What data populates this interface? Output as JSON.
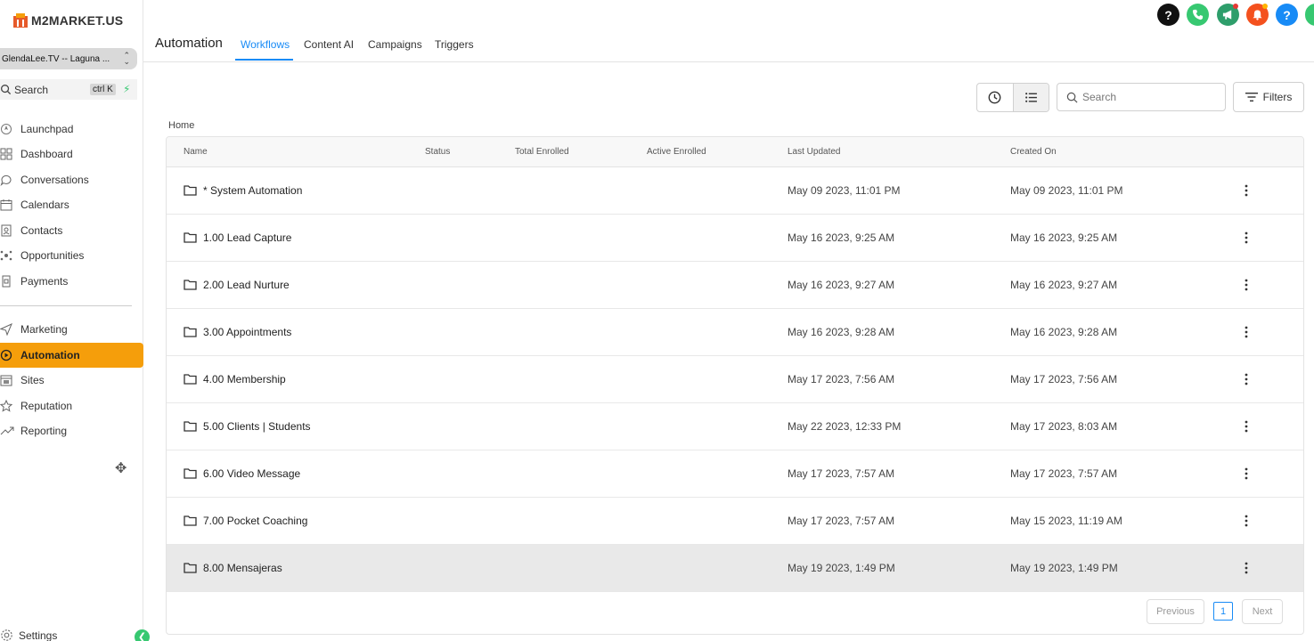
{
  "brand": {
    "logo_text": "M2MARKET.US"
  },
  "sidebar": {
    "location_name": "GlendaLee.TV -- Laguna ...",
    "search_label": "Search",
    "search_shortcut": "ctrl K",
    "items": [
      {
        "label": "Launchpad",
        "icon": "rocket-icon"
      },
      {
        "label": "Dashboard",
        "icon": "grid-icon"
      },
      {
        "label": "Conversations",
        "icon": "chat-icon"
      },
      {
        "label": "Calendars",
        "icon": "calendar-icon"
      },
      {
        "label": "Contacts",
        "icon": "contacts-icon"
      },
      {
        "label": "Opportunities",
        "icon": "opportunities-icon"
      },
      {
        "label": "Payments",
        "icon": "payments-icon"
      },
      {
        "label": "Marketing",
        "icon": "send-icon"
      },
      {
        "label": "Automation",
        "icon": "automation-icon",
        "active": true
      },
      {
        "label": "Sites",
        "icon": "sites-icon"
      },
      {
        "label": "Reputation",
        "icon": "star-icon"
      },
      {
        "label": "Reporting",
        "icon": "trend-icon"
      }
    ],
    "settings_label": "Settings"
  },
  "header": {
    "title": "Automation",
    "tabs": [
      "Workflows",
      "Content AI",
      "Campaigns",
      "Triggers"
    ],
    "active_tab": "Workflows"
  },
  "toolbar": {
    "search_placeholder": "Search",
    "filters_label": "Filters"
  },
  "breadcrumb": "Home",
  "table": {
    "columns": [
      "Name",
      "Status",
      "Total Enrolled",
      "Active Enrolled",
      "Last Updated",
      "Created On"
    ],
    "rows": [
      {
        "name": "* System Automation",
        "last_updated": "May 09 2023, 11:01 PM",
        "created_on": "May 09 2023, 11:01 PM"
      },
      {
        "name": "1.00 Lead Capture",
        "last_updated": "May 16 2023, 9:25 AM",
        "created_on": "May 16 2023, 9:25 AM"
      },
      {
        "name": "2.00 Lead Nurture",
        "last_updated": "May 16 2023, 9:27 AM",
        "created_on": "May 16 2023, 9:27 AM"
      },
      {
        "name": "3.00 Appointments",
        "last_updated": "May 16 2023, 9:28 AM",
        "created_on": "May 16 2023, 9:28 AM"
      },
      {
        "name": "4.00 Membership",
        "last_updated": "May 17 2023, 7:56 AM",
        "created_on": "May 17 2023, 7:56 AM"
      },
      {
        "name": "5.00 Clients | Students",
        "last_updated": "May 22 2023, 12:33 PM",
        "created_on": "May 17 2023, 8:03 AM"
      },
      {
        "name": "6.00 Video Message",
        "last_updated": "May 17 2023, 7:57 AM",
        "created_on": "May 17 2023, 7:57 AM"
      },
      {
        "name": "7.00 Pocket Coaching",
        "last_updated": "May 17 2023, 7:57 AM",
        "created_on": "May 15 2023, 11:19 AM"
      },
      {
        "name": "8.00 Mensajeras",
        "last_updated": "May 19 2023, 1:49 PM",
        "created_on": "May 19 2023, 1:49 PM"
      }
    ]
  },
  "pagination": {
    "previous_label": "Previous",
    "current_page": "1",
    "next_label": "Next"
  },
  "top_icons": [
    {
      "icon": "help-black-icon",
      "glyph": "?",
      "color": "#111111"
    },
    {
      "icon": "phone-icon",
      "glyph": "",
      "color": "#37c871"
    },
    {
      "icon": "megaphone-icon",
      "glyph": "",
      "color": "#2e9e6b"
    },
    {
      "icon": "bell-icon",
      "glyph": "",
      "color": "#f4511e"
    },
    {
      "icon": "help-blue-icon",
      "glyph": "?",
      "color": "#188bf6"
    }
  ],
  "colors": {
    "accent": "#188bf6",
    "active_nav": "#f59e0b",
    "brand_green": "#37c871"
  }
}
